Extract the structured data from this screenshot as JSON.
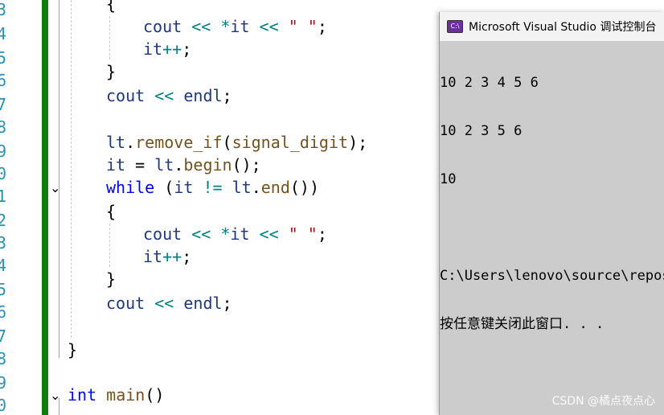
{
  "gutter": {
    "line_numbers": [
      "3",
      "4",
      "5",
      "6",
      "7",
      "8",
      "9",
      "0",
      "1",
      "2",
      "3",
      "4",
      "5",
      "6",
      "7",
      "8",
      "9",
      "0"
    ]
  },
  "code": {
    "lines": [
      {
        "parts": [
          [
            "t",
            "{"
          ]
        ]
      },
      {
        "parts": [
          [
            "vr",
            "cout"
          ],
          [
            "t",
            " "
          ],
          [
            "op",
            "<<"
          ],
          [
            "t",
            " "
          ],
          [
            "op",
            "*"
          ],
          [
            "vr",
            "it"
          ],
          [
            "t",
            " "
          ],
          [
            "op",
            "<<"
          ],
          [
            "t",
            " "
          ],
          [
            "st",
            "\" \""
          ],
          [
            "t",
            ";"
          ]
        ]
      },
      {
        "parts": [
          [
            "vr",
            "it"
          ],
          [
            "op",
            "++"
          ],
          [
            "t",
            ";"
          ]
        ]
      },
      {
        "parts": [
          [
            "t",
            "}"
          ]
        ]
      },
      {
        "parts": [
          [
            "vr",
            "cout"
          ],
          [
            "t",
            " "
          ],
          [
            "op",
            "<<"
          ],
          [
            "t",
            " "
          ],
          [
            "vr",
            "endl"
          ],
          [
            "t",
            ";"
          ]
        ]
      },
      {
        "parts": []
      },
      {
        "parts": [
          [
            "vr",
            "lt"
          ],
          [
            "t",
            "."
          ],
          [
            "fn",
            "remove_if"
          ],
          [
            "t",
            "("
          ],
          [
            "fn",
            "signal_digit"
          ],
          [
            "t",
            ");"
          ]
        ]
      },
      {
        "parts": [
          [
            "vr",
            "it"
          ],
          [
            "t",
            " = "
          ],
          [
            "vr",
            "lt"
          ],
          [
            "t",
            "."
          ],
          [
            "fn",
            "begin"
          ],
          [
            "t",
            "();"
          ]
        ]
      },
      {
        "parts": [
          [
            "kw",
            "while"
          ],
          [
            "t",
            " ("
          ],
          [
            "vr",
            "it"
          ],
          [
            "t",
            " "
          ],
          [
            "op",
            "!="
          ],
          [
            "t",
            " "
          ],
          [
            "vr",
            "lt"
          ],
          [
            "t",
            "."
          ],
          [
            "fn",
            "end"
          ],
          [
            "t",
            "())"
          ]
        ]
      },
      {
        "parts": [
          [
            "t",
            "{"
          ]
        ]
      },
      {
        "parts": [
          [
            "vr",
            "cout"
          ],
          [
            "t",
            " "
          ],
          [
            "op",
            "<<"
          ],
          [
            "t",
            " "
          ],
          [
            "op",
            "*"
          ],
          [
            "vr",
            "it"
          ],
          [
            "t",
            " "
          ],
          [
            "op",
            "<<"
          ],
          [
            "t",
            " "
          ],
          [
            "st",
            "\" \""
          ],
          [
            "t",
            ";"
          ]
        ]
      },
      {
        "parts": [
          [
            "vr",
            "it"
          ],
          [
            "op",
            "++"
          ],
          [
            "t",
            ";"
          ]
        ]
      },
      {
        "parts": [
          [
            "t",
            "}"
          ]
        ]
      },
      {
        "parts": [
          [
            "vr",
            "cout"
          ],
          [
            "t",
            " "
          ],
          [
            "op",
            "<<"
          ],
          [
            "t",
            " "
          ],
          [
            "vr",
            "endl"
          ],
          [
            "t",
            ";"
          ]
        ]
      },
      {
        "parts": []
      },
      {
        "parts": [
          [
            "t",
            "}"
          ]
        ]
      },
      {
        "parts": []
      },
      {
        "parts": [
          [
            "kw",
            "int"
          ],
          [
            "t",
            " "
          ],
          [
            "fn",
            "main"
          ],
          [
            "t",
            "()"
          ]
        ]
      }
    ]
  },
  "console": {
    "title": "Microsoft Visual Studio 调试控制台",
    "icon_text": "C:\\",
    "lines": [
      "10 2 3 4 5 6",
      "10 2 3 5 6",
      "10",
      "",
      "C:\\Users\\lenovo\\source\\repos",
      "按任意键关闭此窗口. . ."
    ]
  },
  "watermark": "CSDN @橘点夜点心",
  "colors": {
    "change_bar": "#107c10",
    "line_number": "#2b91af",
    "keyword": "#0000ff",
    "variable": "#1f377f",
    "function": "#74531f",
    "string": "#a31515",
    "console_bg": "#cccccc"
  }
}
